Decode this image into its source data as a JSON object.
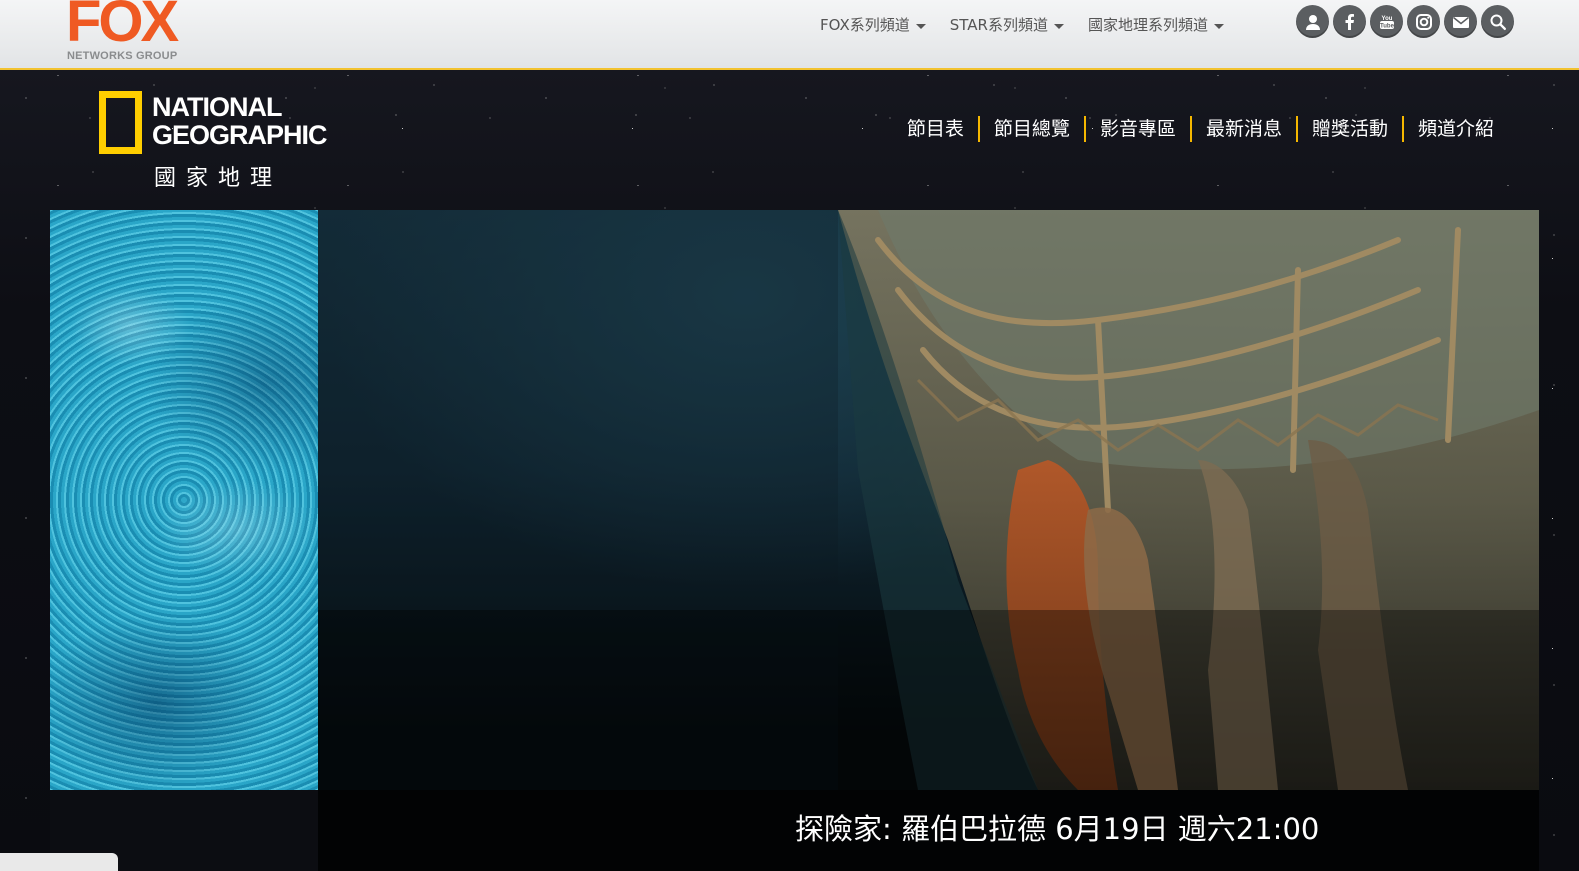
{
  "fox_bar": {
    "logo_word": "FOX",
    "logo_sub": "NETWORKS GROUP",
    "menu": [
      {
        "label": "FOX系列頻道"
      },
      {
        "label": "STAR系列頻道"
      },
      {
        "label": "國家地理系列頻道"
      }
    ],
    "social_icons": [
      "user-icon",
      "facebook-icon",
      "youtube-icon",
      "instagram-icon",
      "mail-icon",
      "search-icon"
    ],
    "accent_color": "#f2c230"
  },
  "natgeo": {
    "logo_line1": "NATIONAL",
    "logo_line2": "GEOGRAPHIC",
    "logo_chinese": "國家地理",
    "brand_color": "#ffce00"
  },
  "main_nav": [
    {
      "label": "節目表"
    },
    {
      "label": "節目總覽"
    },
    {
      "label": "影音專區"
    },
    {
      "label": "最新消息"
    },
    {
      "label": "贈獎活動"
    },
    {
      "label": "頻道介紹"
    }
  ],
  "hero": {
    "caption": "探險家: 羅伯巴拉德 6月19日 週六21:00"
  }
}
